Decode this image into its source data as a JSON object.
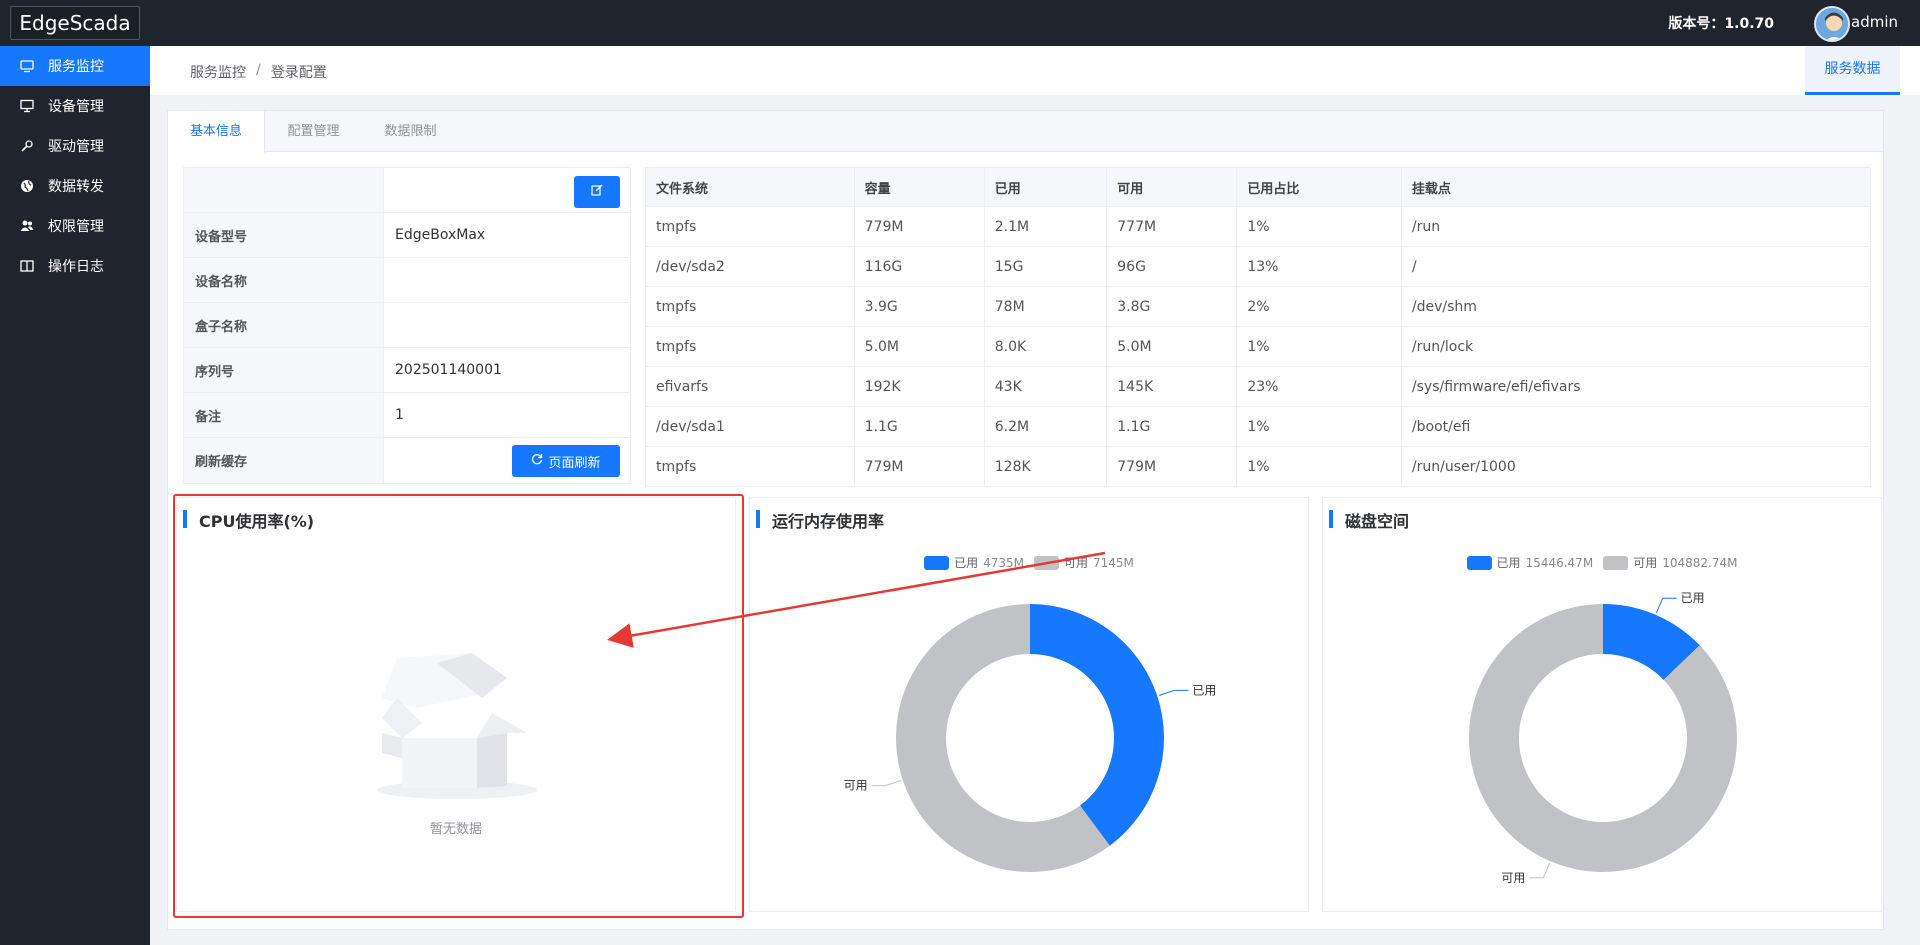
{
  "app": {
    "title": "EdgeScada",
    "version_label": "版本号：1.0.70",
    "user": "admin"
  },
  "sidebar": {
    "items": [
      {
        "label": "服务监控",
        "icon": "monitor-icon"
      },
      {
        "label": "设备管理",
        "icon": "device-icon"
      },
      {
        "label": "驱动管理",
        "icon": "wrench-icon"
      },
      {
        "label": "数据转发",
        "icon": "globe-icon"
      },
      {
        "label": "权限管理",
        "icon": "users-icon"
      },
      {
        "label": "操作日志",
        "icon": "book-icon"
      }
    ]
  },
  "breadcrumb": {
    "items": [
      "服务监控",
      "登录配置"
    ],
    "separator": "/"
  },
  "service_tab": "服务数据",
  "tabs": [
    "基本信息",
    "配置管理",
    "数据限制"
  ],
  "info": {
    "rows": [
      {
        "key": "",
        "value": ""
      },
      {
        "key": "设备型号",
        "value": "EdgeBoxMax"
      },
      {
        "key": "设备名称",
        "value": ""
      },
      {
        "key": "盒子名称",
        "value": ""
      },
      {
        "key": "序列号",
        "value": "202501140001"
      },
      {
        "key": "备注",
        "value": "1"
      },
      {
        "key": "刷新缓存",
        "value": ""
      }
    ],
    "refresh_button": "页面刷新"
  },
  "filesystem": {
    "headers": [
      "文件系统",
      "容量",
      "已用",
      "可用",
      "已用占比",
      "挂载点"
    ],
    "rows": [
      [
        "tmpfs",
        "779M",
        "2.1M",
        "777M",
        "1%",
        "/run"
      ],
      [
        "/dev/sda2",
        "116G",
        "15G",
        "96G",
        "13%",
        "/"
      ],
      [
        "tmpfs",
        "3.9G",
        "78M",
        "3.8G",
        "2%",
        "/dev/shm"
      ],
      [
        "tmpfs",
        "5.0M",
        "8.0K",
        "5.0M",
        "1%",
        "/run/lock"
      ],
      [
        "efivarfs",
        "192K",
        "43K",
        "145K",
        "23%",
        "/sys/firmware/efi/efivars"
      ],
      [
        "/dev/sda1",
        "1.1G",
        "6.2M",
        "1.1G",
        "1%",
        "/boot/efi"
      ],
      [
        "tmpfs",
        "779M",
        "128K",
        "779M",
        "1%",
        "/run/user/1000"
      ]
    ]
  },
  "cpu_card": {
    "title": "CPU使用率(%)",
    "empty_text": "暂无数据"
  },
  "colors": {
    "accent": "#1677ff",
    "used": "#1677ff",
    "free": "#c0c2c6",
    "highlight": "#e53935",
    "sidebar": "#20242c"
  },
  "chart_data": [
    {
      "type": "pie",
      "title": "运行内存使用率",
      "labels": [
        "已用",
        "可用"
      ],
      "legend_values": [
        "4735M",
        "7145M"
      ],
      "values": [
        4735,
        7145
      ],
      "colors": [
        "#1677ff",
        "#c0c2c6"
      ],
      "donut": true,
      "legend": "top-center"
    },
    {
      "type": "pie",
      "title": "磁盘空间",
      "labels": [
        "已用",
        "可用"
      ],
      "legend_values": [
        "15446.47M",
        "104882.74M"
      ],
      "values": [
        15446.47,
        104882.74
      ],
      "colors": [
        "#1677ff",
        "#c0c2c6"
      ],
      "donut": true,
      "legend": "top-center"
    }
  ]
}
